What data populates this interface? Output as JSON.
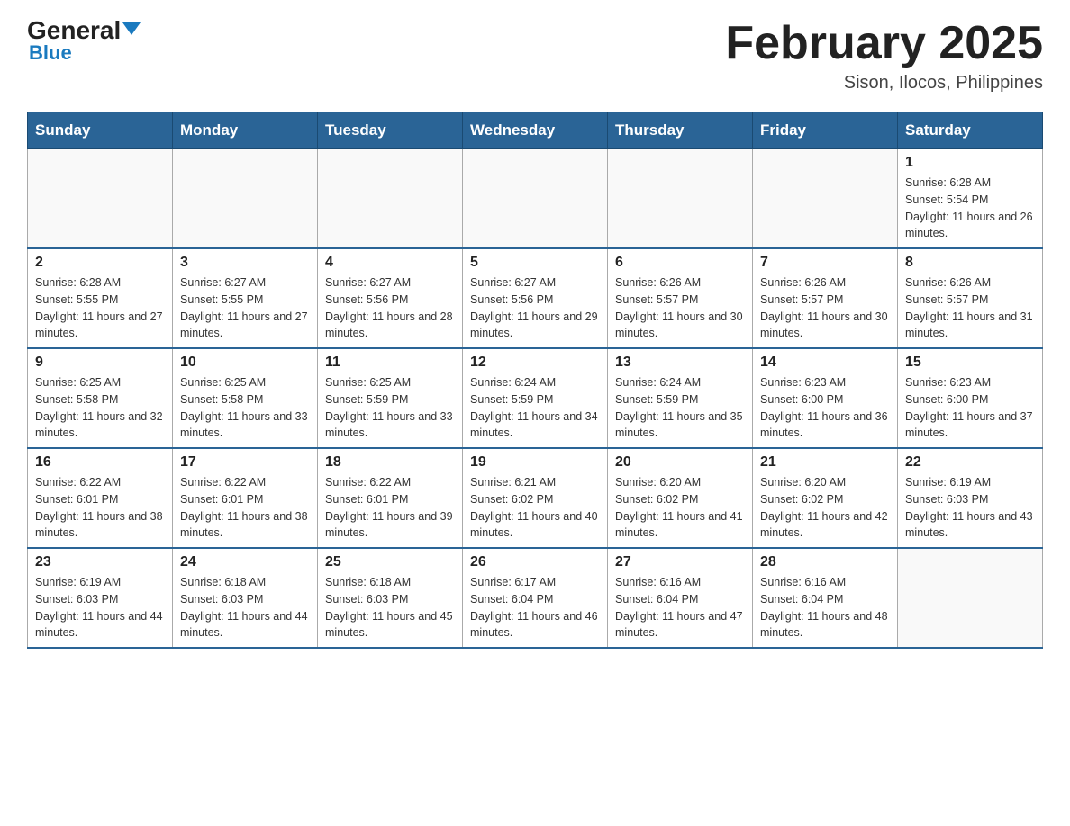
{
  "header": {
    "logo_general": "General",
    "logo_blue": "Blue",
    "month_title": "February 2025",
    "location": "Sison, Ilocos, Philippines"
  },
  "weekdays": [
    "Sunday",
    "Monday",
    "Tuesday",
    "Wednesday",
    "Thursday",
    "Friday",
    "Saturday"
  ],
  "weeks": [
    [
      {
        "day": "",
        "info": ""
      },
      {
        "day": "",
        "info": ""
      },
      {
        "day": "",
        "info": ""
      },
      {
        "day": "",
        "info": ""
      },
      {
        "day": "",
        "info": ""
      },
      {
        "day": "",
        "info": ""
      },
      {
        "day": "1",
        "info": "Sunrise: 6:28 AM\nSunset: 5:54 PM\nDaylight: 11 hours and 26 minutes."
      }
    ],
    [
      {
        "day": "2",
        "info": "Sunrise: 6:28 AM\nSunset: 5:55 PM\nDaylight: 11 hours and 27 minutes."
      },
      {
        "day": "3",
        "info": "Sunrise: 6:27 AM\nSunset: 5:55 PM\nDaylight: 11 hours and 27 minutes."
      },
      {
        "day": "4",
        "info": "Sunrise: 6:27 AM\nSunset: 5:56 PM\nDaylight: 11 hours and 28 minutes."
      },
      {
        "day": "5",
        "info": "Sunrise: 6:27 AM\nSunset: 5:56 PM\nDaylight: 11 hours and 29 minutes."
      },
      {
        "day": "6",
        "info": "Sunrise: 6:26 AM\nSunset: 5:57 PM\nDaylight: 11 hours and 30 minutes."
      },
      {
        "day": "7",
        "info": "Sunrise: 6:26 AM\nSunset: 5:57 PM\nDaylight: 11 hours and 30 minutes."
      },
      {
        "day": "8",
        "info": "Sunrise: 6:26 AM\nSunset: 5:57 PM\nDaylight: 11 hours and 31 minutes."
      }
    ],
    [
      {
        "day": "9",
        "info": "Sunrise: 6:25 AM\nSunset: 5:58 PM\nDaylight: 11 hours and 32 minutes."
      },
      {
        "day": "10",
        "info": "Sunrise: 6:25 AM\nSunset: 5:58 PM\nDaylight: 11 hours and 33 minutes."
      },
      {
        "day": "11",
        "info": "Sunrise: 6:25 AM\nSunset: 5:59 PM\nDaylight: 11 hours and 33 minutes."
      },
      {
        "day": "12",
        "info": "Sunrise: 6:24 AM\nSunset: 5:59 PM\nDaylight: 11 hours and 34 minutes."
      },
      {
        "day": "13",
        "info": "Sunrise: 6:24 AM\nSunset: 5:59 PM\nDaylight: 11 hours and 35 minutes."
      },
      {
        "day": "14",
        "info": "Sunrise: 6:23 AM\nSunset: 6:00 PM\nDaylight: 11 hours and 36 minutes."
      },
      {
        "day": "15",
        "info": "Sunrise: 6:23 AM\nSunset: 6:00 PM\nDaylight: 11 hours and 37 minutes."
      }
    ],
    [
      {
        "day": "16",
        "info": "Sunrise: 6:22 AM\nSunset: 6:01 PM\nDaylight: 11 hours and 38 minutes."
      },
      {
        "day": "17",
        "info": "Sunrise: 6:22 AM\nSunset: 6:01 PM\nDaylight: 11 hours and 38 minutes."
      },
      {
        "day": "18",
        "info": "Sunrise: 6:22 AM\nSunset: 6:01 PM\nDaylight: 11 hours and 39 minutes."
      },
      {
        "day": "19",
        "info": "Sunrise: 6:21 AM\nSunset: 6:02 PM\nDaylight: 11 hours and 40 minutes."
      },
      {
        "day": "20",
        "info": "Sunrise: 6:20 AM\nSunset: 6:02 PM\nDaylight: 11 hours and 41 minutes."
      },
      {
        "day": "21",
        "info": "Sunrise: 6:20 AM\nSunset: 6:02 PM\nDaylight: 11 hours and 42 minutes."
      },
      {
        "day": "22",
        "info": "Sunrise: 6:19 AM\nSunset: 6:03 PM\nDaylight: 11 hours and 43 minutes."
      }
    ],
    [
      {
        "day": "23",
        "info": "Sunrise: 6:19 AM\nSunset: 6:03 PM\nDaylight: 11 hours and 44 minutes."
      },
      {
        "day": "24",
        "info": "Sunrise: 6:18 AM\nSunset: 6:03 PM\nDaylight: 11 hours and 44 minutes."
      },
      {
        "day": "25",
        "info": "Sunrise: 6:18 AM\nSunset: 6:03 PM\nDaylight: 11 hours and 45 minutes."
      },
      {
        "day": "26",
        "info": "Sunrise: 6:17 AM\nSunset: 6:04 PM\nDaylight: 11 hours and 46 minutes."
      },
      {
        "day": "27",
        "info": "Sunrise: 6:16 AM\nSunset: 6:04 PM\nDaylight: 11 hours and 47 minutes."
      },
      {
        "day": "28",
        "info": "Sunrise: 6:16 AM\nSunset: 6:04 PM\nDaylight: 11 hours and 48 minutes."
      },
      {
        "day": "",
        "info": ""
      }
    ]
  ]
}
